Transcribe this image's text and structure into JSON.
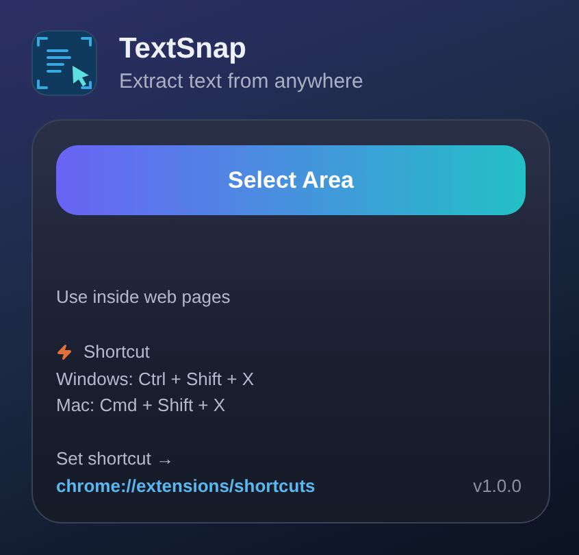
{
  "header": {
    "title": "TextSnap",
    "subtitle": "Extract text from anywhere"
  },
  "card": {
    "button": "Select Area",
    "hint": "Use inside web pages",
    "shortcut": {
      "heading": "Shortcut",
      "lines": [
        "Windows: Ctrl + Shift + X",
        "Mac: Cmd + Shift + X"
      ]
    },
    "set_shortcut": "Set shortcut →",
    "link": "chrome://extensions/shortcuts",
    "version": "v1.0.0"
  }
}
